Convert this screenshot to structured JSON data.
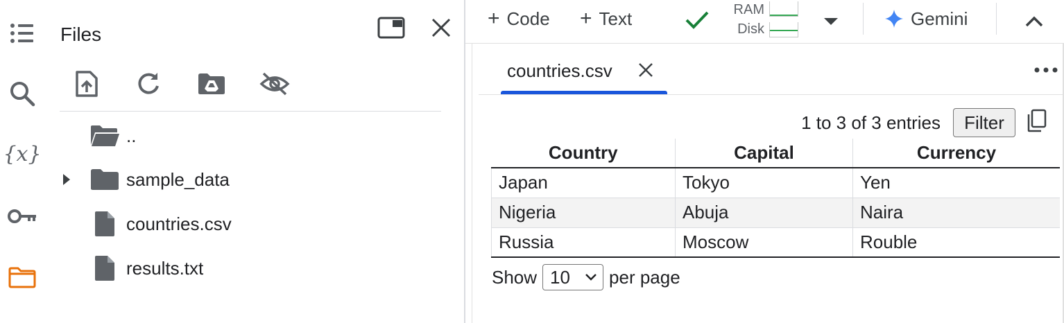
{
  "rail": {
    "items": [
      {
        "name": "table-of-contents",
        "icon": "list-icon"
      },
      {
        "name": "search",
        "icon": "search-icon"
      },
      {
        "name": "variables",
        "icon": "variables-icon",
        "glyph": "{x}"
      },
      {
        "name": "secrets",
        "icon": "key-icon"
      },
      {
        "name": "files",
        "icon": "folder-icon",
        "active": true
      }
    ],
    "active_color": "#e8710a"
  },
  "files_panel": {
    "title": "Files",
    "toolbar": [
      "upload-icon",
      "refresh-icon",
      "drive-icon",
      "hide-hidden-files-icon"
    ],
    "tree": [
      {
        "label": "..",
        "type": "parent-folder"
      },
      {
        "label": "sample_data",
        "type": "folder",
        "expandable": true
      },
      {
        "label": "countries.csv",
        "type": "file"
      },
      {
        "label": "results.txt",
        "type": "file"
      }
    ]
  },
  "toolbar": {
    "code_label": "Code",
    "text_label": "Text",
    "connected_color": "#188038",
    "ram_label": "RAM",
    "disk_label": "Disk",
    "gemini_label": "Gemini",
    "gemini_color": "#4285f4"
  },
  "editor": {
    "tab_label": "countries.csv",
    "accent": "#1a56db",
    "entries_text": "1 to 3 of 3 entries",
    "filter_label": "Filter",
    "table": {
      "headers": [
        "Country",
        "Capital",
        "Currency"
      ],
      "rows": [
        [
          "Japan",
          "Tokyo",
          "Yen"
        ],
        [
          "Nigeria",
          "Abuja",
          "Naira"
        ],
        [
          "Russia",
          "Moscow",
          "Rouble"
        ]
      ]
    },
    "pager": {
      "show_label": "Show",
      "page_size": "10",
      "per_page_label": "per page"
    }
  }
}
